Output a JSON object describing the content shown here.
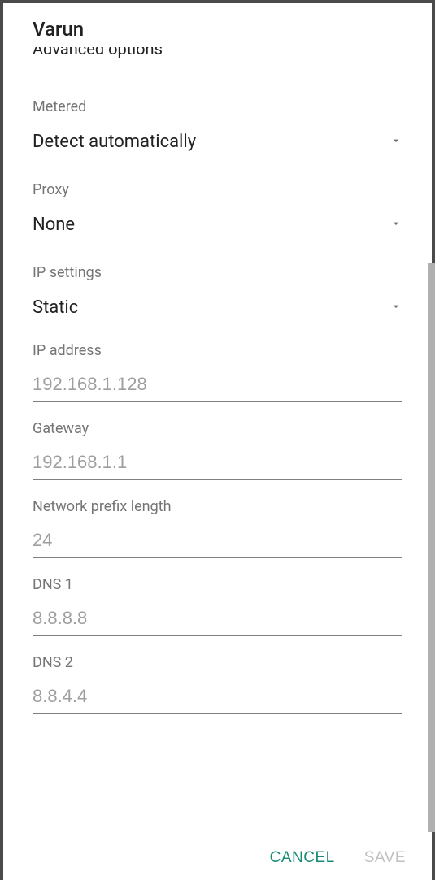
{
  "dialog": {
    "title": "Varun",
    "cutoff_row": "Advanced options"
  },
  "metered": {
    "label": "Metered",
    "value": "Detect automatically"
  },
  "proxy": {
    "label": "Proxy",
    "value": "None"
  },
  "ip_settings": {
    "label": "IP settings",
    "value": "Static"
  },
  "ip_address": {
    "label": "IP address",
    "placeholder": "192.168.1.128"
  },
  "gateway": {
    "label": "Gateway",
    "placeholder": "192.168.1.1"
  },
  "prefix": {
    "label": "Network prefix length",
    "placeholder": "24"
  },
  "dns1": {
    "label": "DNS 1",
    "placeholder": "8.8.8.8"
  },
  "dns2": {
    "label": "DNS 2",
    "placeholder": "8.8.4.4"
  },
  "buttons": {
    "cancel": "CANCEL",
    "save": "SAVE"
  }
}
